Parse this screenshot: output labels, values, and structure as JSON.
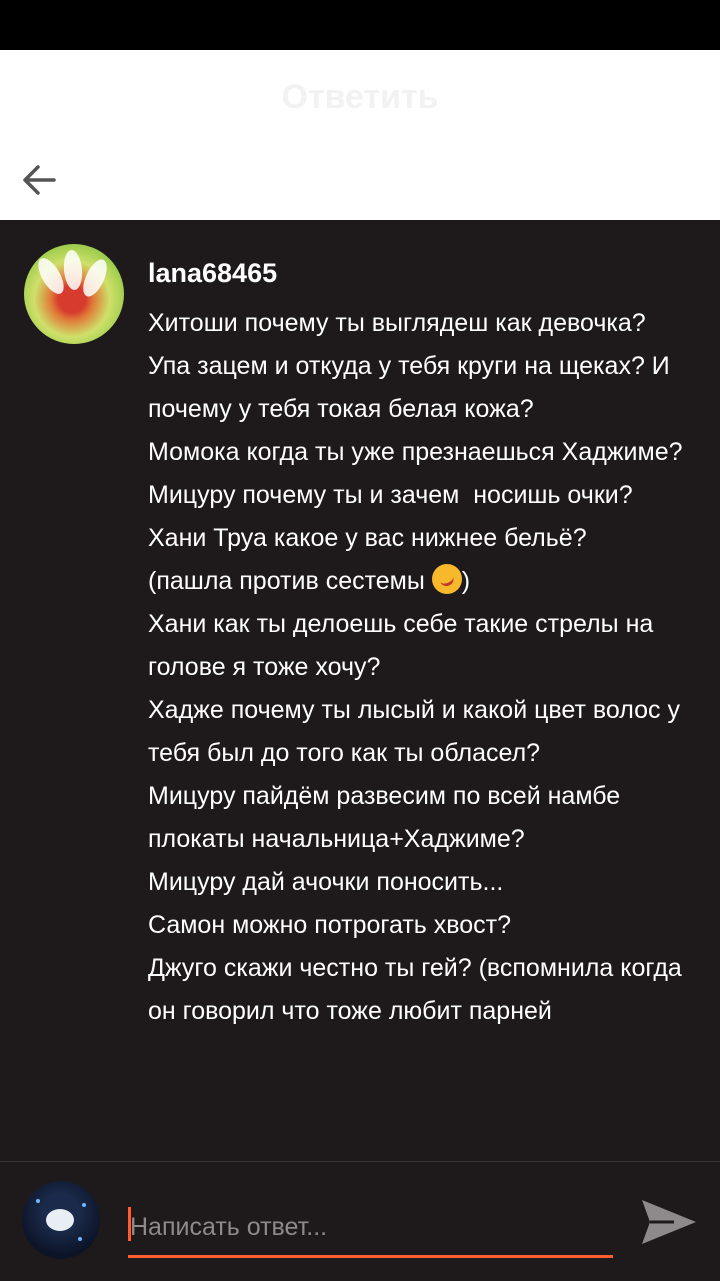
{
  "header": {
    "title": "Ответить",
    "back_icon": "arrow-left-icon"
  },
  "comment": {
    "author": "lana68465",
    "lines": [
      "Хитоши почему ты выглядеш как девочка?",
      "Упа зацем и откуда у тебя круги на щеках? И почему у тебя токая белая кожа?",
      "Момока когда ты уже презнаешься Хаджиме?",
      "Мицуру почему ты и зачем  носишь очки?",
      "Хани Труа какое у вас нижнее бельё?",
      "(пашла против сестемы ",
      ")",
      "Хани как ты делоешь себе такие стрелы на голове я тоже хочу?",
      "Хадже почему ты лысый и какой цвет волос у тебя был до того как ты обласел?",
      "Мицуру пайдём развесим по всей намбе плокаты начальница+Хаджиме?",
      "Мицуру дай ачочки поносить...",
      "Самон можно потрогать хвост?",
      "Джуго скажи честно ты гей? (вспомнила когда он говорил что тоже любит парней"
    ]
  },
  "composer": {
    "placeholder": "Написать ответ...",
    "value": "",
    "send_icon": "send-icon"
  },
  "colors": {
    "accent": "#ff5c2f",
    "background": "#1e1a1c",
    "header_bg": "#ffffff"
  }
}
